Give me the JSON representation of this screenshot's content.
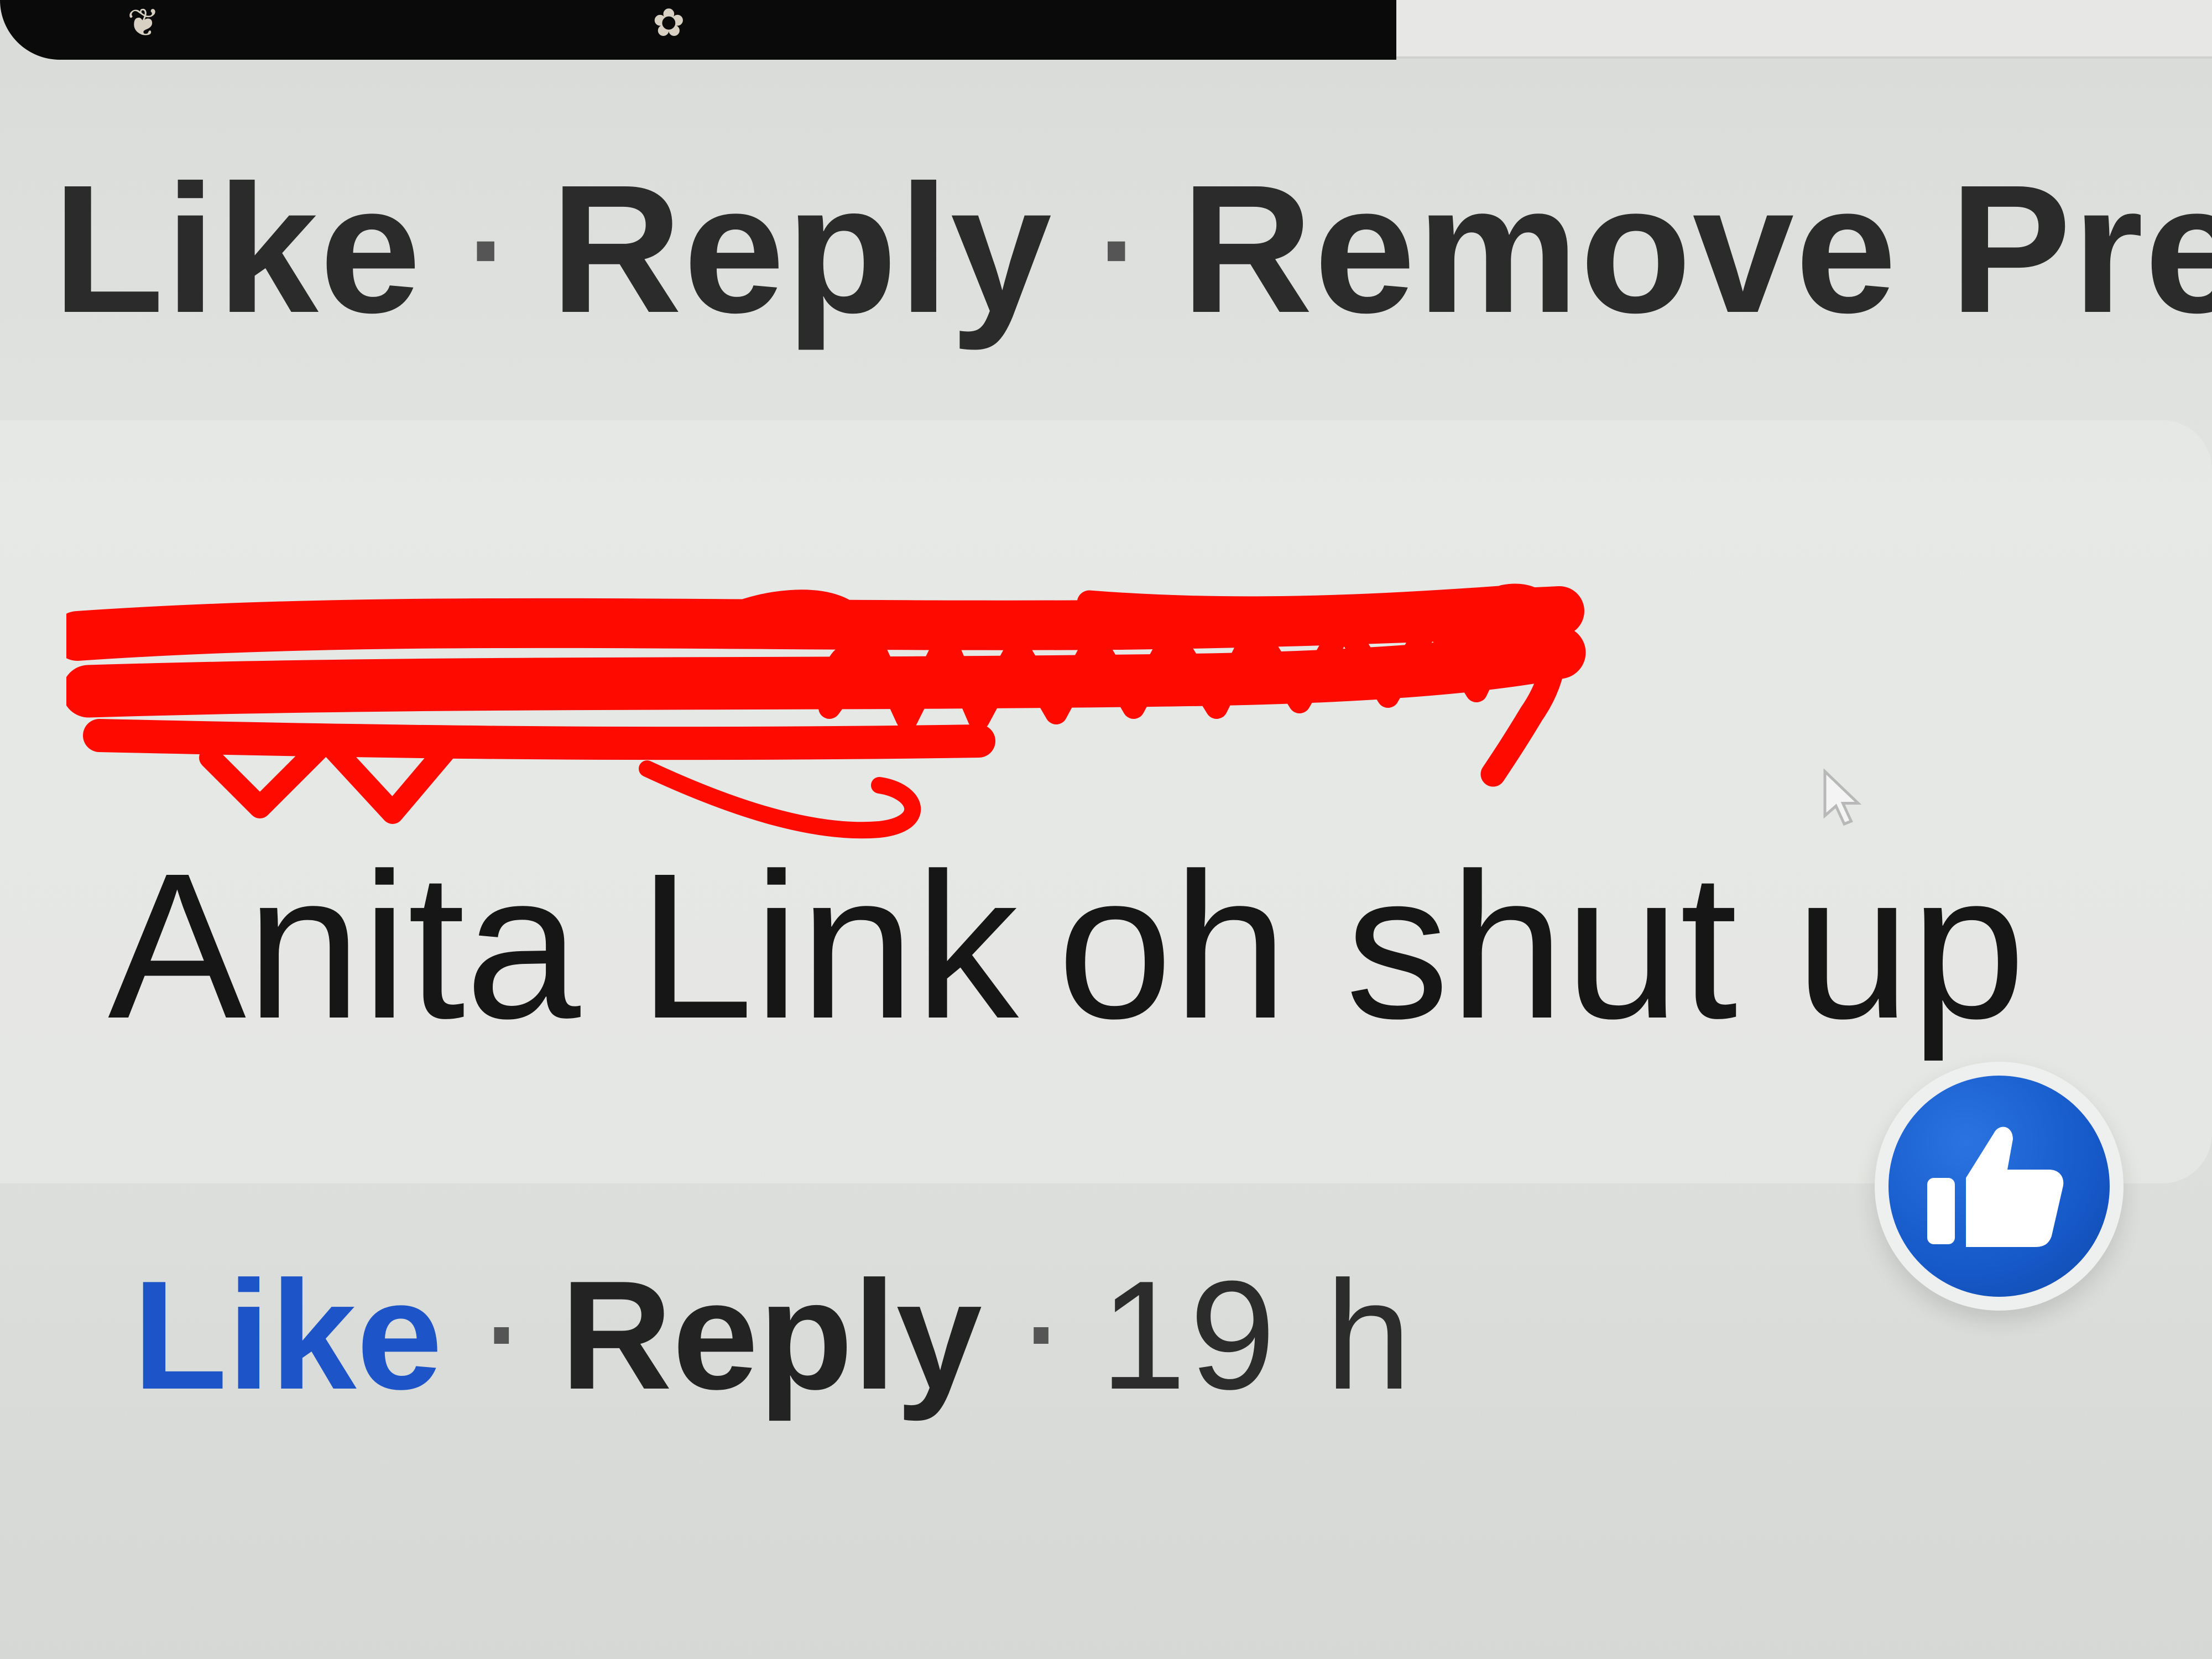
{
  "previous_comment_actions": {
    "like_label": "Like",
    "separator": "·",
    "reply_label": "Reply",
    "remove_preview_label": "Remove Pre"
  },
  "comment": {
    "author_name": "",
    "mention": "Anita Link",
    "text": "oh shut up",
    "actions": {
      "like_label": "Like",
      "separator": "·",
      "reply_label": "Reply",
      "timestamp": "19 h"
    },
    "reaction_icon": "thumbs-up-icon",
    "liked": true
  },
  "colors": {
    "liked_blue": "#1d55c8",
    "reaction_blue": "#1659c9",
    "redaction_red": "#ff0a00",
    "text_dark": "#232323",
    "background": "#e2e4e2"
  }
}
